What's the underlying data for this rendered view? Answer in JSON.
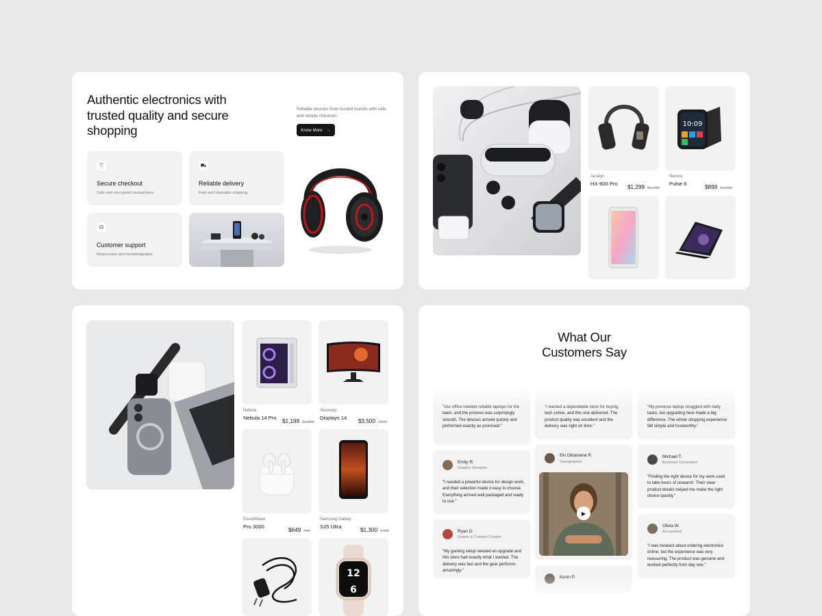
{
  "hero": {
    "title": "Authentic electronics with trusted quality and secure shopping",
    "subtitle": "Reliable devices from trusted brands with safe and simple checkout.",
    "cta_label": "Know More",
    "features": [
      {
        "title": "Secure checkout",
        "desc": "Safe and encrypted transactions.",
        "icon": "shield-check-icon"
      },
      {
        "title": "Reliable delivery",
        "desc": "Fast and trackable shipping.",
        "icon": "truck-icon"
      },
      {
        "title": "Customer support",
        "desc": "Responsive and knowledgeable",
        "icon": "headset-icon"
      }
    ]
  },
  "grid_top": {
    "products": [
      {
        "brand": "Auralyn",
        "name": "HX-900 Pro",
        "price": "$1,299",
        "old_price": "$1,499",
        "icon": "headphones-image"
      },
      {
        "brand": "Nexora",
        "name": "Pulse 6",
        "price": "$899",
        "old_price": "$1,099",
        "icon": "smartwatch-image"
      },
      {
        "icon": "smartphone-image"
      },
      {
        "icon": "laptop-image"
      }
    ]
  },
  "grid_bottom": {
    "products": [
      {
        "brand": "Nebula",
        "name": "Nebula 14 Pro",
        "price": "$1,199",
        "old_price": "$1,399",
        "icon": "pc-case-image"
      },
      {
        "brand": "Visionary",
        "name": "Displays 14",
        "price": "$3,500",
        "old_price": "4000",
        "icon": "monitor-image"
      },
      {
        "brand": "SoundWave",
        "name": "Pro 3000",
        "price": "$649",
        "old_price": "799",
        "icon": "earbuds-image"
      },
      {
        "brand": "Samsung Galaxy",
        "name": "S25 Ultra",
        "price": "$1,300",
        "old_price": "1499",
        "icon": "phone-image"
      },
      {
        "icon": "charger-image"
      },
      {
        "icon": "watch-image"
      }
    ]
  },
  "testimonials": {
    "title_line1": "What Our",
    "title_line2": "Customers Say",
    "col1": [
      {
        "quote": "\"Our office needed reliable laptops for the team, and the process was surprisingly smooth. The devices arrived quickly and performed exactly as promised.\""
      },
      {
        "name": "Emily R.",
        "role": "Graphic Designer",
        "quote": "\"I needed a powerful device for design work, and their selection made it easy to choose. Everything arrived well packaged and ready to use.\""
      },
      {
        "name": "Ryan D.",
        "role": "Gamer & Content Creator",
        "quote": "\"My gaming setup needed an upgrade and this store had exactly what I wanted. The delivery was fast and the gear performs amazingly.\""
      }
    ],
    "col2": [
      {
        "quote": "\"I wanted a dependable store for buying tech online, and this one delivered. The product quality was excellent and the delivery was right on time.\""
      },
      {
        "name": "Eki Oktaviana R.",
        "role": "Sonographer"
      },
      {
        "name": "Kevin P."
      }
    ],
    "col3": [
      {
        "quote": "\"My previous laptop struggled with daily tasks, but upgrading here made a big difference. The whole shopping experience felt simple and trustworthy.\""
      },
      {
        "name": "Michael T.",
        "role": "Business Consultant",
        "quote": "\"Finding the right device for my work used to take hours of research. Their clear product details helped me make the right choice quickly.\""
      },
      {
        "name": "Olivia W.",
        "role": "Accountant",
        "quote": "\"I was hesitant about ordering electronics online, but the experience was very reassuring. The product was genuine and worked perfectly from day one.\""
      }
    ]
  }
}
